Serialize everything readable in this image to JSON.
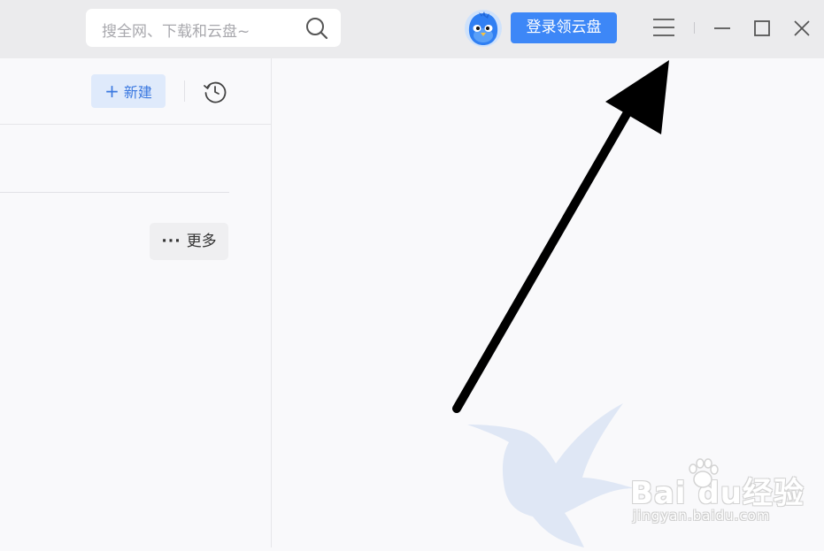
{
  "titlebar": {
    "search_placeholder": "搜全网、下载和云盘~",
    "login_label": "登录领云盘"
  },
  "toolbar": {
    "new_label": "新建",
    "more_label": "更多"
  },
  "watermark": {
    "brand_text": "Bai du经验",
    "url_text": "jingyan.baidu.com"
  },
  "colors": {
    "accent": "#3d87f7",
    "titlebar_bg": "#ebebed",
    "bird_watermark": "#dfe7f5"
  },
  "icons": [
    "search-icon",
    "avatar-icon",
    "menu-icon",
    "minimize-icon",
    "maximize-icon",
    "close-icon",
    "plus-icon",
    "history-icon",
    "more-dots-icon",
    "bird-logo",
    "arrow-annotation"
  ]
}
